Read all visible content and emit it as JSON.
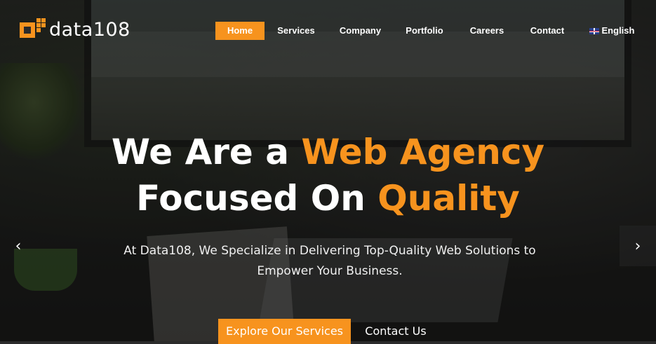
{
  "brand": {
    "logo_text": "data108",
    "accent_color": "#f7931e"
  },
  "nav": {
    "items": [
      {
        "label": "Home",
        "active": true
      },
      {
        "label": "Services",
        "active": false
      },
      {
        "label": "Company",
        "active": false
      },
      {
        "label": "Portfolio",
        "active": false
      },
      {
        "label": "Careers",
        "active": false
      },
      {
        "label": "Contact",
        "active": false
      }
    ],
    "language": {
      "label": "English",
      "icon": "uk-flag-icon"
    }
  },
  "hero": {
    "line1_pre": "We Are a ",
    "line1_accent": "Web Agency",
    "line2_pre": "Focused On ",
    "line2_accent": "Quality",
    "subtitle_line1": "At Data108, We Specialize in Delivering Top-Quality Web Solutions to",
    "subtitle_line2": "Empower Your Business.",
    "primary_cta": "Explore Our Services",
    "secondary_cta": "Contact Us"
  },
  "carousel": {
    "prev_icon": "chevron-left-icon",
    "next_icon": "chevron-right-icon",
    "prev_glyph": "‹",
    "next_glyph": "›"
  }
}
